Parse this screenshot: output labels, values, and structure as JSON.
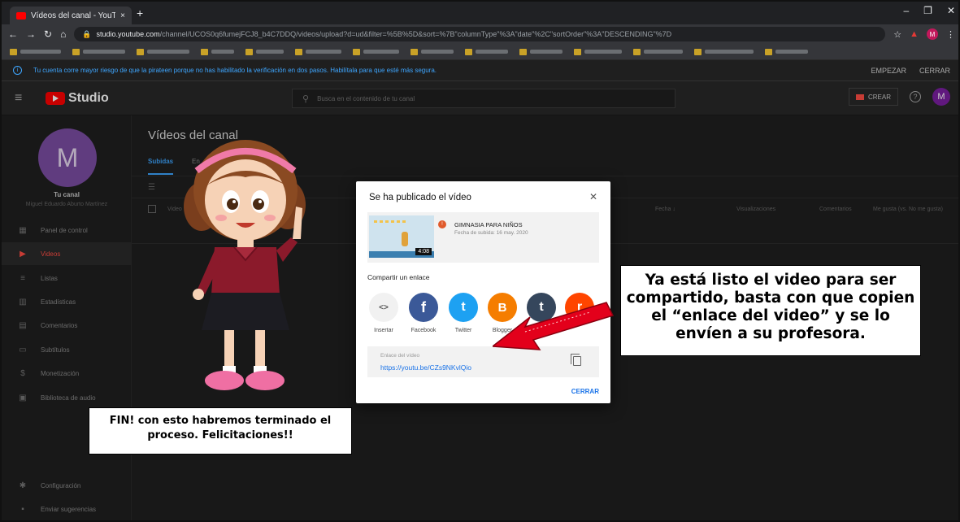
{
  "browser": {
    "tab_title": "Vídeos del canal - YouTube Stud",
    "tab_close": "×",
    "new_tab": "+",
    "url_host": "studio.youtube.com",
    "url_path": "/channel/UCOS0q6fumejFCJ8_b4C7DDQ/videos/upload?d=ud&filter=%5B%5D&sort=%7B\"columnType\"%3A\"date\"%2C\"sortOrder\"%3A\"DESCENDING\"%7D",
    "profile_initial": "M"
  },
  "warning": {
    "message": "Tu cuenta corre mayor riesgo de que la pirateen porque no has habilitado la verificación en dos pasos. Habilítala para que esté más segura.",
    "start_button": "EMPEZAR",
    "close_button": "CERRAR"
  },
  "studio_header": {
    "logo_text": "Studio",
    "search_placeholder": "Busca en el contenido de tu canal",
    "create_button": "CREAR",
    "help": "?",
    "avatar_initial": "M"
  },
  "sidebar": {
    "avatar_initial": "M",
    "channel_label": "Tu canal",
    "channel_owner": "Miguel Eduardo Aburto Martínez",
    "items": [
      {
        "label": "Panel de control",
        "icon": "dashboard-icon",
        "glyph": "▦"
      },
      {
        "label": "Videos",
        "icon": "video-icon",
        "glyph": "▶"
      },
      {
        "label": "Listas",
        "icon": "playlist-icon",
        "glyph": "≡"
      },
      {
        "label": "Estadísticas",
        "icon": "analytics-icon",
        "glyph": "▥"
      },
      {
        "label": "Comentarios",
        "icon": "comments-icon",
        "glyph": "▤"
      },
      {
        "label": "Subtítulos",
        "icon": "subtitles-icon",
        "glyph": "▭"
      },
      {
        "label": "Monetización",
        "icon": "dollar-icon",
        "glyph": "$"
      },
      {
        "label": "Biblioteca de audio",
        "icon": "audio-library-icon",
        "glyph": "▣"
      }
    ],
    "bottom_items": [
      {
        "label": "Configuración",
        "icon": "gear-icon",
        "glyph": "✱"
      },
      {
        "label": "Enviar sugerencias",
        "icon": "feedback-icon",
        "glyph": "▪"
      }
    ]
  },
  "main": {
    "title": "Vídeos del canal",
    "tab_uploads": "Subidas",
    "tab_live": "En",
    "columns": {
      "video": "Video",
      "date": "Fecha ↓",
      "views": "Visualizaciones",
      "comments": "Comentarios",
      "likes": "Me gusta (vs. No me gusta)"
    }
  },
  "modal": {
    "title": "Se ha publicado el vídeo",
    "video_title": "GIMNASIA PARA NIÑOS",
    "video_date": "Fecha de subida: 16 may. 2020",
    "duration": "4:08",
    "share_label": "Compartir un enlace",
    "share_targets": [
      {
        "label": "Insertar",
        "icon": "embed-icon",
        "color": "#f1f1f1",
        "glyph": "<>"
      },
      {
        "label": "Facebook",
        "icon": "facebook-icon",
        "color": "#3b5998",
        "glyph": "f"
      },
      {
        "label": "Twitter",
        "icon": "twitter-icon",
        "color": "#1da1f2",
        "glyph": "t"
      },
      {
        "label": "Blogger",
        "icon": "blogger-icon",
        "color": "#f57d00",
        "glyph": "B"
      },
      {
        "label": "",
        "icon": "tumblr-icon",
        "color": "#35465c",
        "glyph": "t"
      },
      {
        "label": "",
        "icon": "reddit-icon",
        "color": "#ff4500",
        "glyph": "r"
      }
    ],
    "link_label": "Enlace del vídeo",
    "link_url": "https://youtu.be/CZs9NKvlQio",
    "close_button": "CERRAR"
  },
  "annotations": {
    "right": "Ya está listo el video para ser compartido, basta con que copien el “enlace del video” y se lo envíen a su profesora.",
    "left": "FIN! con esto habremos terminado el proceso. Felicitaciones!!"
  }
}
